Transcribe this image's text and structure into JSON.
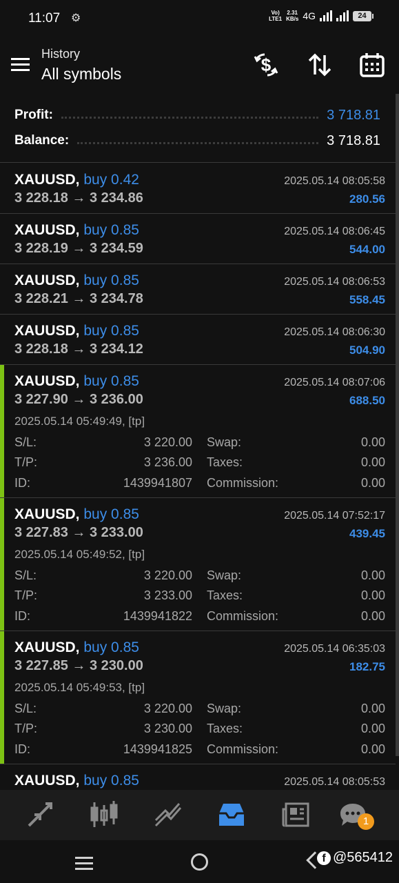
{
  "status_bar": {
    "time": "11:07",
    "volte": "Vo\nLTE1",
    "speed_top": "2.31",
    "speed_bottom": "KB/s",
    "network": "4G",
    "battery": "24"
  },
  "app_bar": {
    "subtitle": "History",
    "title": "All symbols",
    "icons": [
      "menu-icon",
      "deposit-withdraw-icon",
      "sort-icon",
      "calendar-icon"
    ]
  },
  "summary": {
    "profit_label": "Profit:",
    "profit_value": "3 718.81",
    "balance_label": "Balance:",
    "balance_value": "3 718.81"
  },
  "deals": [
    {
      "symbol": "XAUUSD,",
      "side": "buy 0.42",
      "time": "2025.05.14 08:05:58",
      "prices": "3 228.18 → 3 234.86",
      "profit": "280.56"
    },
    {
      "symbol": "XAUUSD,",
      "side": "buy 0.85",
      "time": "2025.05.14 08:06:45",
      "prices": "3 228.19 → 3 234.59",
      "profit": "544.00"
    },
    {
      "symbol": "XAUUSD,",
      "side": "buy 0.85",
      "time": "2025.05.14 08:06:53",
      "prices": "3 228.21 → 3 234.78",
      "profit": "558.45"
    },
    {
      "symbol": "XAUUSD,",
      "side": "buy 0.85",
      "time": "2025.05.14 08:06:30",
      "prices": "3 228.18 → 3 234.12",
      "profit": "504.90"
    },
    {
      "symbol": "XAUUSD,",
      "side": "buy 0.85",
      "time": "2025.05.14 08:07:06",
      "prices": "3 227.90 → 3 236.00",
      "profit": "688.50",
      "open": "2025.05.14 05:49:49, [tp]",
      "sl_label": "S/L:",
      "sl": "3 220.00",
      "tp_label": "T/P:",
      "tp": "3 236.00",
      "id_label": "ID:",
      "id": "1439941807",
      "swap_label": "Swap:",
      "swap": "0.00",
      "taxes_label": "Taxes:",
      "taxes": "0.00",
      "commission_label": "Commission:",
      "commission": "0.00"
    },
    {
      "symbol": "XAUUSD,",
      "side": "buy 0.85",
      "time": "2025.05.14 07:52:17",
      "prices": "3 227.83 → 3 233.00",
      "profit": "439.45",
      "open": "2025.05.14 05:49:52, [tp]",
      "sl_label": "S/L:",
      "sl": "3 220.00",
      "tp_label": "T/P:",
      "tp": "3 233.00",
      "id_label": "ID:",
      "id": "1439941822",
      "swap_label": "Swap:",
      "swap": "0.00",
      "taxes_label": "Taxes:",
      "taxes": "0.00",
      "commission_label": "Commission:",
      "commission": "0.00"
    },
    {
      "symbol": "XAUUSD,",
      "side": "buy 0.85",
      "time": "2025.05.14 06:35:03",
      "prices": "3 227.85 → 3 230.00",
      "profit": "182.75",
      "open": "2025.05.14 05:49:53, [tp]",
      "sl_label": "S/L:",
      "sl": "3 220.00",
      "tp_label": "T/P:",
      "tp": "3 230.00",
      "id_label": "ID:",
      "id": "1439941825",
      "swap_label": "Swap:",
      "swap": "0.00",
      "taxes_label": "Taxes:",
      "taxes": "0.00",
      "commission_label": "Commission:",
      "commission": "0.00"
    },
    {
      "symbol": "XAUUSD,",
      "side": "buy 0.85",
      "time": "2025.05.14 08:05:53",
      "prices": "",
      "profit": ""
    }
  ],
  "bottom_nav": {
    "items": [
      "quotes-icon",
      "chart-icon",
      "trade-icon",
      "history-icon",
      "news-icon",
      "messages-icon"
    ],
    "active": "history-icon",
    "messages_badge": "1"
  },
  "watermark": "@565412",
  "colors": {
    "accent_blue": "#3d8de8",
    "closed_bar": "#7dc214",
    "background": "#121212",
    "badge": "#f29b1d"
  }
}
